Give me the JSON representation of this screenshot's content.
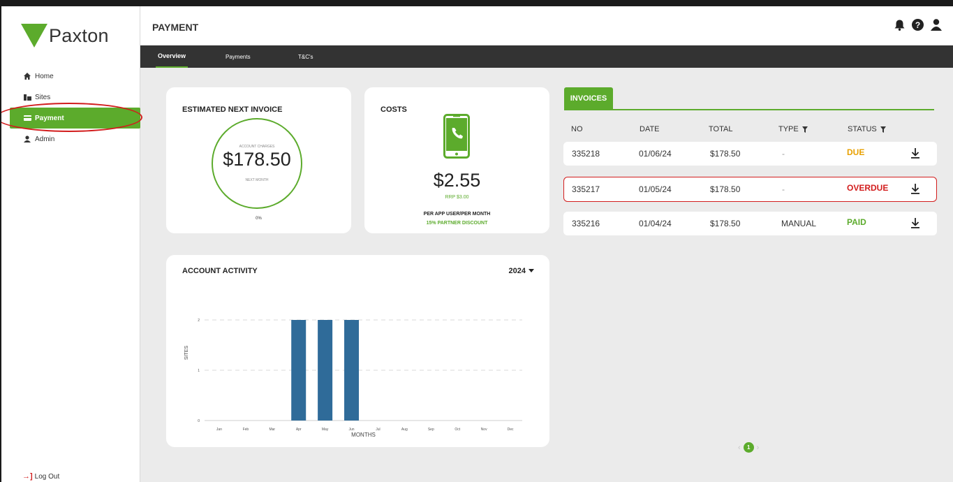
{
  "brand": {
    "name": "Paxton",
    "accent": "#5cab2c",
    "alert": "#d21d1d",
    "warning": "#e8a000"
  },
  "sidebar": {
    "items": [
      {
        "label": "Home",
        "icon": "home-icon"
      },
      {
        "label": "Sites",
        "icon": "sites-icon"
      },
      {
        "label": "Payment",
        "icon": "payment-icon",
        "active": true
      },
      {
        "label": "Admin",
        "icon": "user-icon"
      }
    ],
    "logout": "Log Out"
  },
  "header": {
    "title": "PAYMENT",
    "icons": [
      "bell-icon",
      "help-icon",
      "user-icon"
    ]
  },
  "tabs": [
    {
      "label": "Overview",
      "active": true
    },
    {
      "label": "Payments"
    },
    {
      "label": "T&C's"
    }
  ],
  "estimate": {
    "title": "ESTIMATED NEXT INVOICE",
    "top_label": "ACCOUNT CHARGES",
    "amount": "$178.50",
    "bottom_label": "NEXT MONTH",
    "percent": "0%"
  },
  "costs": {
    "title": "COSTS",
    "icon": "phone-icon",
    "amount": "$2.55",
    "rrp": "RRP $3.00",
    "per": "PER APP USER/PER MONTH",
    "discount": "15% PARTNER DISCOUNT"
  },
  "invoices": {
    "tab": "INVOICES",
    "headers": {
      "no": "NO",
      "date": "DATE",
      "total": "TOTAL",
      "type": "TYPE",
      "status": "STATUS"
    },
    "rows": [
      {
        "no": "335218",
        "date": "01/06/24",
        "total": "$178.50",
        "type": "-",
        "status": "DUE"
      },
      {
        "no": "335217",
        "date": "01/05/24",
        "total": "$178.50",
        "type": "-",
        "status": "OVERDUE"
      },
      {
        "no": "335216",
        "date": "01/04/24",
        "total": "$178.50",
        "type": "MANUAL",
        "status": "PAID"
      }
    ],
    "page": "1"
  },
  "activity": {
    "title": "ACCOUNT ACTIVITY",
    "year": "2024"
  },
  "chart_data": {
    "type": "bar",
    "categories": [
      "Jan",
      "Feb",
      "Mar",
      "Apr",
      "May",
      "Jun",
      "Jul",
      "Aug",
      "Sep",
      "Oct",
      "Nov",
      "Dec"
    ],
    "values": [
      0,
      0,
      0,
      2,
      2,
      2,
      0,
      0,
      0,
      0,
      0,
      0
    ],
    "yticks": [
      "0",
      "1",
      "2"
    ],
    "ylim": [
      0,
      2
    ],
    "xlabel": "MONTHS",
    "ylabel": "SITES",
    "grid": true,
    "bar_color": "#2f6b99"
  }
}
